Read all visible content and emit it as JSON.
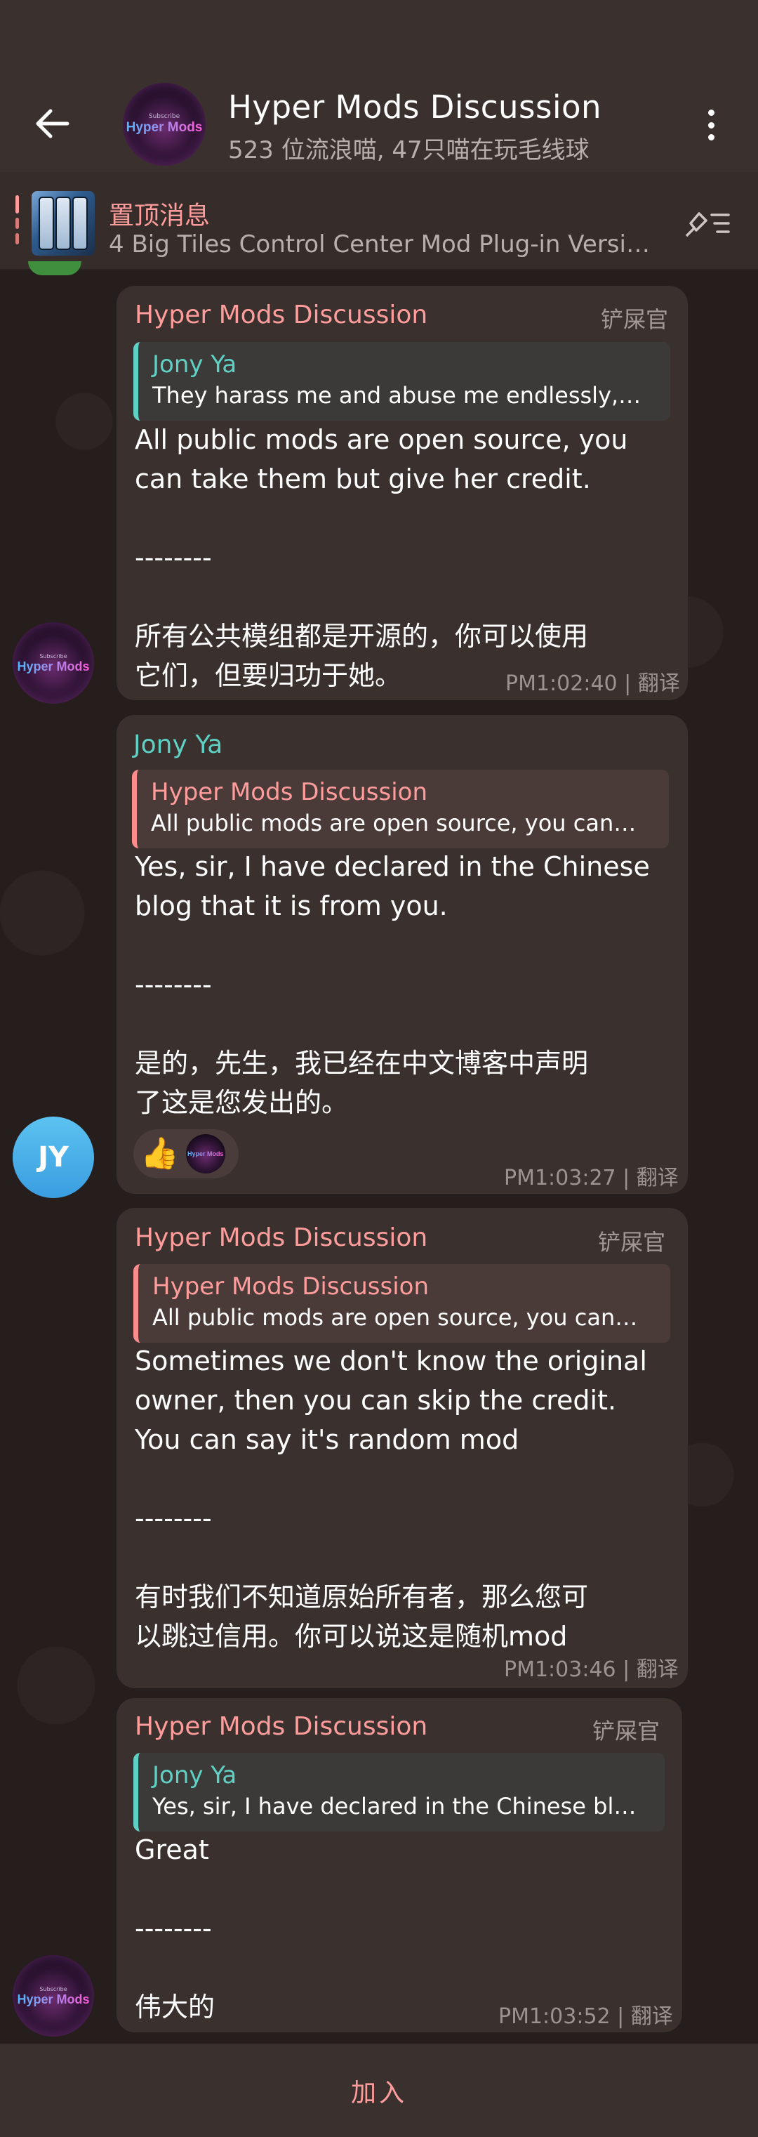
{
  "header": {
    "title": "Hyper Mods Discussion",
    "subtitle": "523 位流浪喵, 47只喵在玩毛线球",
    "avatar_small_text": "Subscribe",
    "avatar_brand": "Hyper Mods"
  },
  "pinned": {
    "label": "置顶消息",
    "text": "4 Big Tiles Control Center Mod Plug-in Versi…"
  },
  "messages": [
    {
      "sender": "Hyper Mods Discussion",
      "role": "铲屎官",
      "reply_name": "Jony Ya",
      "reply_text": "They harass me and abuse me endlessly,…",
      "text": "All public mods are open source, you\ncan take them but give her credit.\n\n--------\n\n所有公共模组都是开源的，你可以使用\n它们，但要归功于她。",
      "time": "PM1:02:40 | 翻译"
    },
    {
      "sender": "Jony Ya",
      "reply_name": "Hyper Mods Discussion",
      "reply_text": "All public mods are open source, you can…",
      "text": "Yes, sir, I have declared in the Chinese\nblog that it is from you.\n\n--------\n\n是的，先生，我已经在中文博客中声明\n了这是您发出的。",
      "reaction_emoji": "👍",
      "avatar_initials": "JY",
      "time": "PM1:03:27 | 翻译"
    },
    {
      "sender": "Hyper Mods Discussion",
      "role": "铲屎官",
      "reply_name": "Hyper Mods Discussion",
      "reply_text": "All public mods are open source, you can…",
      "text": "Sometimes we don't know the original\nowner, then you can skip the credit.\nYou can say it's random mod\n\n--------\n\n有时我们不知道原始所有者，那么您可\n以跳过信用。你可以说这是随机mod",
      "time": "PM1:03:46 | 翻译"
    },
    {
      "sender": "Hyper Mods Discussion",
      "role": "铲屎官",
      "reply_name": "Jony Ya",
      "reply_text": "Yes, sir, I have declared in the Chinese bl…",
      "text": "Great\n\n--------\n\n伟大的",
      "time": "PM1:03:52 | 翻译"
    }
  ],
  "footer": {
    "join_label": "加入"
  },
  "colors": {
    "header_bg": "#3a302e",
    "chat_bg": "#261e1c",
    "bubble_bg": "#3a302e",
    "group_name": "#ff9c9c",
    "user_name": "#5fd1c4",
    "meta": "#9d9290"
  },
  "icons": {
    "back": "arrow-left-icon",
    "more": "more-vertical-icon",
    "pin_list": "pin-list-icon"
  }
}
